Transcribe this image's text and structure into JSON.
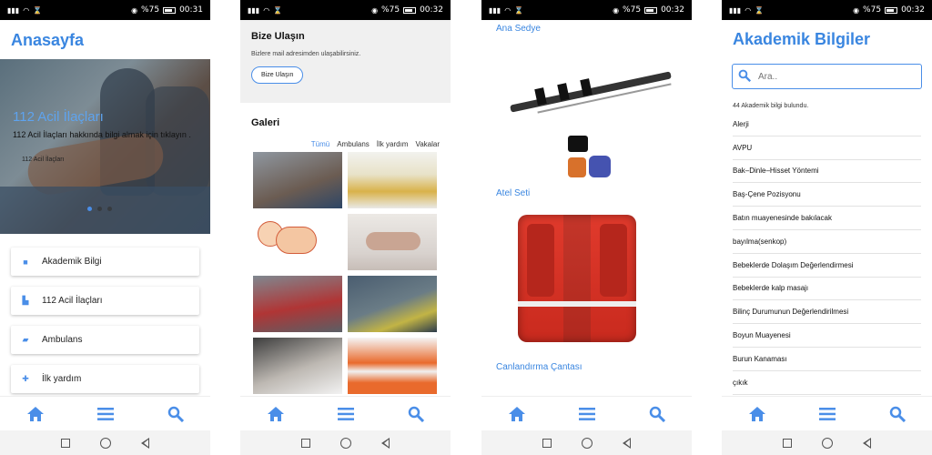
{
  "status_bars": [
    {
      "signal": "|||",
      "battery_text": "%75",
      "time": "00:31"
    },
    {
      "signal": "|||",
      "battery_text": "%75",
      "time": "00:32"
    },
    {
      "signal": "|||",
      "battery_text": "%75",
      "time": "00:32"
    },
    {
      "signal": "|||",
      "battery_text": "%75",
      "time": "00:32"
    }
  ],
  "screen1": {
    "title": "Anasayfa",
    "hero": {
      "title": "112 Acil İlaçları",
      "subtitle": "112 Acil İlaçları hakkında bilgi almak için tıklayın .",
      "link": "112 Acil İlaçları",
      "slide_count": 3,
      "active_slide": 1
    },
    "menu": [
      {
        "label": "Akademik Bilgi",
        "icon": "book-icon"
      },
      {
        "label": "112 Acil İlaçları",
        "icon": "medicine-icon"
      },
      {
        "label": "Ambulans",
        "icon": "ambulance-icon"
      },
      {
        "label": "İlk yardım",
        "icon": "first-aid-icon"
      }
    ]
  },
  "screen2": {
    "contact_title": "Bize Ulaşın",
    "contact_desc": "Bizlere mail adresimden ulaşabilirsiniz.",
    "contact_button": "Bize Ulaşın",
    "gallery_title": "Galeri",
    "filters": [
      "Tümü",
      "Ambulans",
      "İlk yardım",
      "Vakalar"
    ],
    "active_filter": "Tümü"
  },
  "screen3": {
    "items": [
      "Ana Sedye",
      "Atel Seti",
      "Canlandırma Çantası"
    ]
  },
  "screen4": {
    "title": "Akademik Bilgiler",
    "search_placeholder": "Ara..",
    "count_text": "44 Akademik bilgi bulundu.",
    "items": [
      "Alerji",
      "AVPU",
      "Bak–Dinle–Hisset Yöntemi",
      "Baş-Çene Pozisyonu",
      "Batın muayenesinde bakılacak",
      "bayılma(senkop)",
      "Bebeklerde Dolaşım Değerlendirmesi",
      "Bebeklerde kalp masajı",
      "Bilinç Durumunun Değerlendirilmesi",
      "Boyun Muayenesi",
      "Burun Kanaması",
      "çıkık"
    ]
  },
  "colors": {
    "accent": "#4a8ee8",
    "title_blue": "#3a86e0"
  },
  "nav_icons": [
    "home-icon",
    "menu-icon",
    "search-icon"
  ]
}
